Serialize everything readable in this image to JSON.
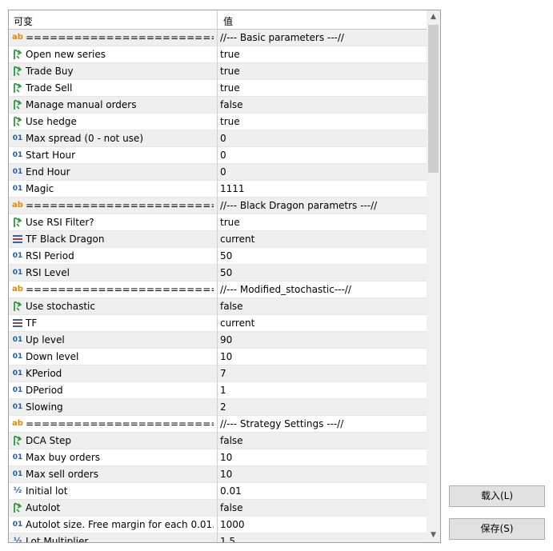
{
  "header": {
    "col_name": "可变",
    "col_value": "值"
  },
  "rows": [
    {
      "icon": "ab",
      "name": "=============================",
      "value": "//--- Basic parameters ---//"
    },
    {
      "icon": "bool",
      "name": "Open new series",
      "value": "true"
    },
    {
      "icon": "bool",
      "name": "Trade Buy",
      "value": "true"
    },
    {
      "icon": "bool",
      "name": "Trade Sell",
      "value": "true"
    },
    {
      "icon": "bool",
      "name": "Manage manual orders",
      "value": "false"
    },
    {
      "icon": "bool",
      "name": "Use hedge",
      "value": "true"
    },
    {
      "icon": "01",
      "name": "Max spread (0 - not use)",
      "value": "0"
    },
    {
      "icon": "01",
      "name": "Start Hour",
      "value": "0"
    },
    {
      "icon": "01",
      "name": "End Hour",
      "value": "0"
    },
    {
      "icon": "01",
      "name": "Magic",
      "value": "1111"
    },
    {
      "icon": "ab",
      "name": "=============================",
      "value": "//--- Black Dragon parametrs ---//"
    },
    {
      "icon": "bool",
      "name": "Use RSI Filter?",
      "value": "true"
    },
    {
      "icon": "enum",
      "name": "TF Black Dragon",
      "value": "current"
    },
    {
      "icon": "01",
      "name": "RSI Period",
      "value": "50"
    },
    {
      "icon": "01",
      "name": "RSI Level",
      "value": "50"
    },
    {
      "icon": "ab",
      "name": "=============================",
      "value": "//--- Modified_stochastic---//"
    },
    {
      "icon": "bool",
      "name": "Use stochastic",
      "value": "false"
    },
    {
      "icon": "enum",
      "name": "TF",
      "value": "current"
    },
    {
      "icon": "01",
      "name": "Up level",
      "value": "90"
    },
    {
      "icon": "01",
      "name": "Down level",
      "value": "10"
    },
    {
      "icon": "01",
      "name": "KPeriod",
      "value": "7"
    },
    {
      "icon": "01",
      "name": "DPeriod",
      "value": "1"
    },
    {
      "icon": "01",
      "name": "Slowing",
      "value": "2"
    },
    {
      "icon": "ab",
      "name": "=============================",
      "value": "//--- Strategy Settings ---//"
    },
    {
      "icon": "bool",
      "name": "DCA Step",
      "value": "false"
    },
    {
      "icon": "01",
      "name": "Max buy orders",
      "value": "10"
    },
    {
      "icon": "01",
      "name": "Max sell orders",
      "value": "10"
    },
    {
      "icon": "half",
      "name": "Initial lot",
      "value": "0.01"
    },
    {
      "icon": "bool",
      "name": "Autolot",
      "value": "false"
    },
    {
      "icon": "01",
      "name": "Autolot size. Free margin for each 0.01...",
      "value": "1000"
    },
    {
      "icon": "half",
      "name": "Lot Multiplier",
      "value": "1.5"
    }
  ],
  "icon_text": {
    "ab": "ab",
    "01": "01",
    "half": "½"
  },
  "scrollbar": {
    "up_arrow": "▲",
    "down_arrow": "▼"
  },
  "buttons": {
    "load": "载入(L)",
    "save": "保存(S)"
  },
  "colors": {
    "ab_icon": "#e08a00",
    "bool_icon": "#2e9a3a",
    "num_icon": "#1a5ea8",
    "enum_icon": "#3a5fb0",
    "alt_row": "#efefef"
  }
}
